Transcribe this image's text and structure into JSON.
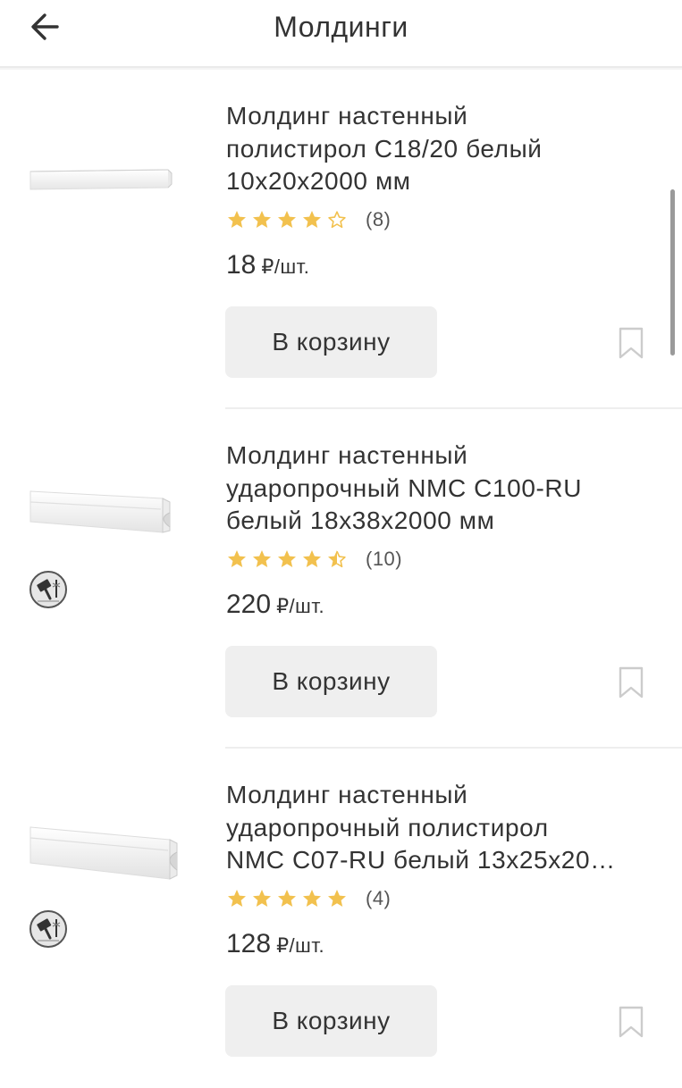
{
  "header": {
    "title": "Молдинги",
    "back_icon": "arrow-left-icon"
  },
  "colors": {
    "star": "#F2C14E",
    "button_bg": "#EFEFEF",
    "text": "#333333",
    "divider": "#EEEEEE"
  },
  "products": [
    {
      "title": "Молдинг настенный\nполистирол С18/20 белый\n10х20х2000 мм",
      "rating": 4,
      "reviews": "(8)",
      "price": "18",
      "unit": "₽/шт.",
      "cart_label": "В корзину",
      "has_badge": false
    },
    {
      "title": "Молдинг настенный\nударопрочный NMC C100-RU\nбелый 18х38х2000 мм",
      "rating": 4.5,
      "reviews": "(10)",
      "price": "220",
      "unit": "₽/шт.",
      "cart_label": "В корзину",
      "has_badge": true,
      "badge_icon": "impact-resistant-hammer-icon"
    },
    {
      "title": "Молдинг настенный\nударопрочный полистирол\nNMC C07-RU белый 13х25х20…",
      "rating": 5,
      "reviews": "(4)",
      "price": "128",
      "unit": "₽/шт.",
      "cart_label": "В корзину",
      "has_badge": true,
      "badge_icon": "impact-resistant-hammer-icon"
    }
  ]
}
